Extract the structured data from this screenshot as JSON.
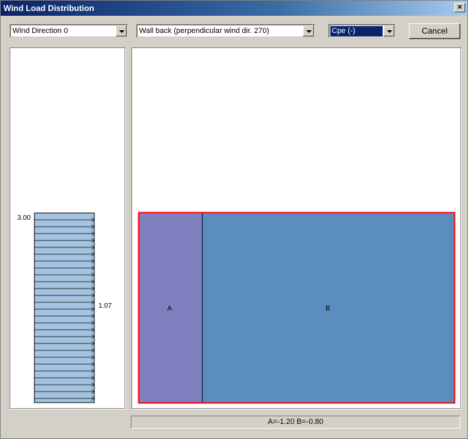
{
  "window": {
    "title": "Wind Load Distribution",
    "close_glyph": "×"
  },
  "toolbar": {
    "direction_select": "Wind Direction 0",
    "surface_select": "Wall back (perpendicular wind dir. 270)",
    "coefficient_select": "Cpe (-)",
    "cancel_label": "Cancel"
  },
  "profile": {
    "top_label": "3.00",
    "side_label": "1.07"
  },
  "zones": [
    {
      "label": "A",
      "color": "#8080c0",
      "value": "-1.20"
    },
    {
      "label": "B",
      "color": "#5b8dbe",
      "value": "-0.80"
    }
  ],
  "status": {
    "text": "A=-1.20 B=-0.80"
  },
  "colors": {
    "profile_fill": "#a3c3e0",
    "zone_border": "#ff0000",
    "titlebar": "#0a246a"
  }
}
